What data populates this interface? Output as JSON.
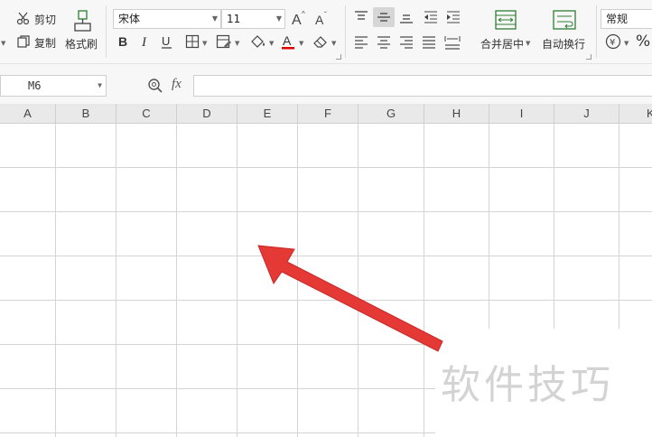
{
  "toolbar": {
    "cut_label": "剪切",
    "copy_label": "复制",
    "format_painter_label": "格式刷",
    "font_name": "宋体",
    "font_size": "11",
    "merge_center_label": "合并居中",
    "wrap_text_label": "自动换行",
    "number_format": "常规",
    "percent_symbol": "%",
    "currency_symbol": "¥"
  },
  "formula_bar": {
    "name_box": "M6",
    "fx_label": "fx",
    "formula_value": ""
  },
  "sheet": {
    "columns": [
      "A",
      "B",
      "C",
      "D",
      "E",
      "F",
      "G",
      "H",
      "I",
      "J",
      "K"
    ]
  },
  "watermark": {
    "text": "软件技巧"
  },
  "colors": {
    "arrow": "#e53935",
    "font_color_underline": "#e00000",
    "grid_line": "#d4d4d4"
  }
}
